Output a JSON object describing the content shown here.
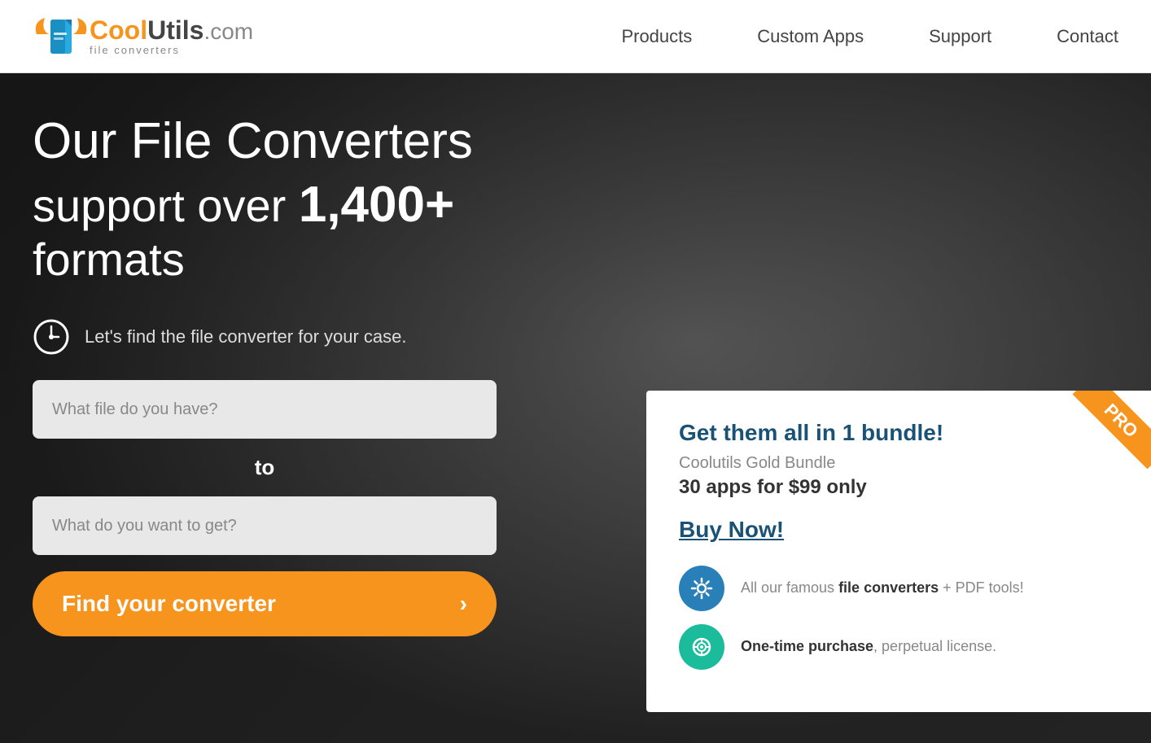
{
  "header": {
    "logo": {
      "cool": "Cool",
      "utils": "Utils",
      "com": ".com",
      "pipe": "|",
      "subtitle": "file converters"
    },
    "nav": {
      "items": [
        {
          "id": "products",
          "label": "Products"
        },
        {
          "id": "custom-apps",
          "label": "Custom Apps"
        },
        {
          "id": "support",
          "label": "Support"
        },
        {
          "id": "contact",
          "label": "Contact"
        }
      ]
    }
  },
  "hero": {
    "title": "Our File Converters",
    "subtitle_start": "support over ",
    "subtitle_bold": "1,400+",
    "subtitle_end": "",
    "formats": "formats",
    "desc": "Let's find the file converter for your case.",
    "input1_placeholder": "What file do you have?",
    "to_label": "to",
    "input2_placeholder": "What do you want to get?",
    "find_button": "Find your converter",
    "find_button_arrow": "›"
  },
  "promo": {
    "ribbon": "PRO",
    "title": "Get them all in 1 bundle!",
    "subtitle": "Coolutils Gold Bundle",
    "price": "30 apps for $99 only",
    "buy_label": "Buy Now!",
    "features": [
      {
        "icon": "gear",
        "text_start": "All our famous ",
        "text_bold": "file converters",
        "text_end": " + PDF tools!"
      },
      {
        "icon": "chart",
        "text_start": "",
        "text_bold": "One-time purchase",
        "text_end": ", perpetual license."
      }
    ]
  }
}
